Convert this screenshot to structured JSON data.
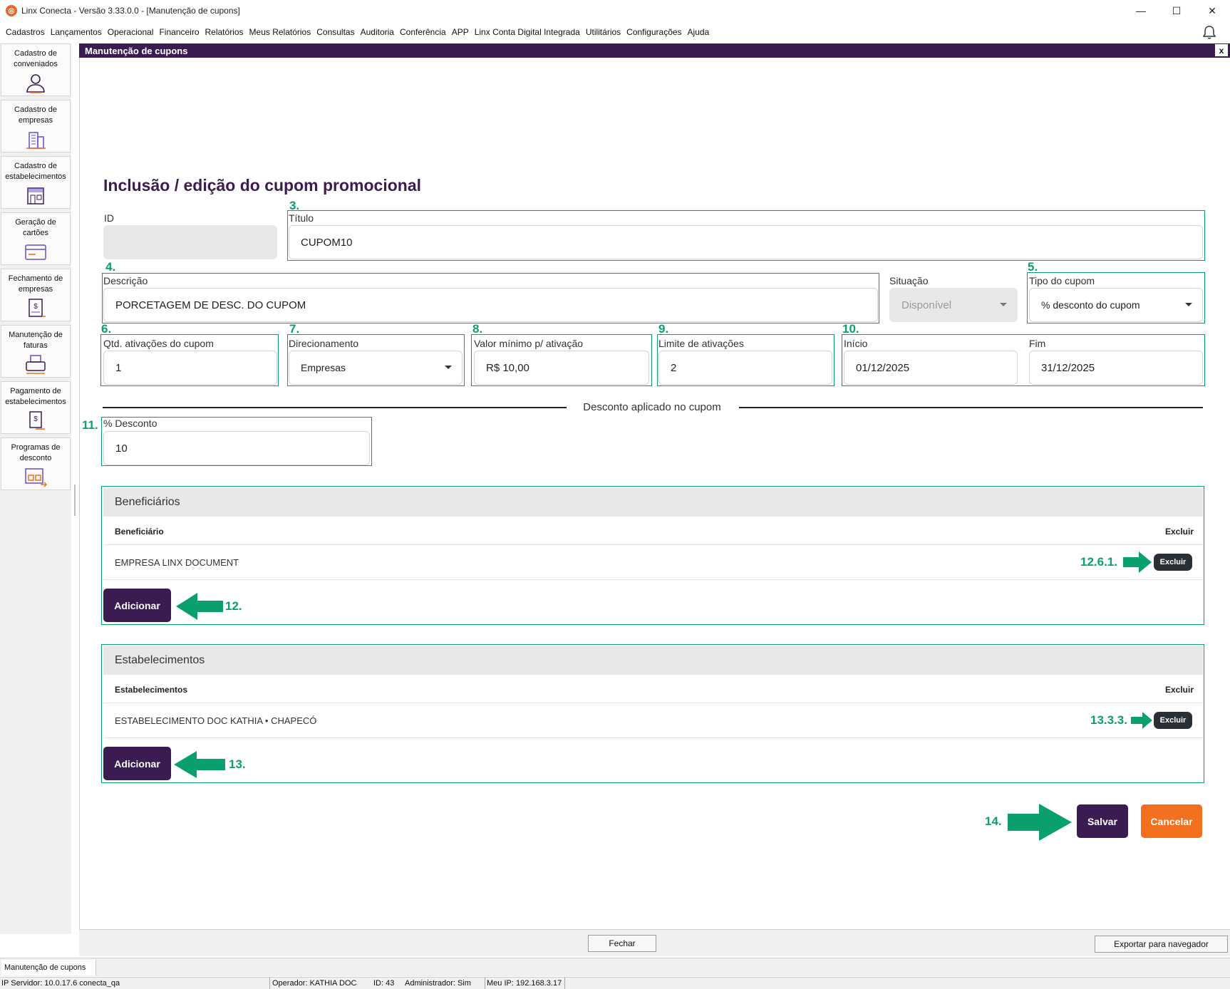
{
  "window": {
    "title": "Linx Conecta - Versão 3.33.0.0 - [Manutenção de cupons]",
    "minimize": "—",
    "maximize": "☐",
    "close": "✕"
  },
  "menu": [
    "Cadastros",
    "Lançamentos",
    "Operacional",
    "Financeiro",
    "Relatórios",
    "Meus Relatórios",
    "Consultas",
    "Auditoria",
    "Conferência",
    "APP",
    "Linx Conta Digital Integrada",
    "Utilitários",
    "Configurações",
    "Ajuda"
  ],
  "sidebar": [
    {
      "label": "Cadastro de conveniados",
      "icon": "user-icon"
    },
    {
      "label": "Cadastro de empresas",
      "icon": "building-icon"
    },
    {
      "label": "Cadastro de estabelecimentos",
      "icon": "storefront-icon"
    },
    {
      "label": "Geração de cartões",
      "icon": "card-icon"
    },
    {
      "label": "Fechamento de empresas",
      "icon": "invoice-dollar-icon"
    },
    {
      "label": "Manutenção de faturas",
      "icon": "printer-icon"
    },
    {
      "label": "Pagamento de estabelecimentos",
      "icon": "payment-icon"
    },
    {
      "label": "Programas de desconto",
      "icon": "discount-program-icon"
    }
  ],
  "document": {
    "header": "Manutenção de cupons",
    "close": "x",
    "page_title": "Inclusão / edição do cupom promocional"
  },
  "form": {
    "id": {
      "label": "ID",
      "value": ""
    },
    "titulo": {
      "label": "Título",
      "value": "CUPOM10",
      "callout": "3."
    },
    "descricao": {
      "label": "Descrição",
      "value": "PORCETAGEM DE DESC. DO CUPOM",
      "callout": "4."
    },
    "situacao": {
      "label": "Situação",
      "value": "Disponível"
    },
    "tipo": {
      "label": "Tipo do cupom",
      "value": "% desconto do cupom",
      "callout": "5."
    },
    "qtd": {
      "label": "Qtd. ativações do cupom",
      "value": "1",
      "callout": "6."
    },
    "direcionamento": {
      "label": "Direcionamento",
      "value": "Empresas",
      "callout": "7."
    },
    "valor_minimo": {
      "label": "Valor mínimo p/ ativação",
      "value": "R$ 10,00",
      "callout": "8."
    },
    "limite": {
      "label": "Limite de ativações",
      "value": "2",
      "callout": "9."
    },
    "inicio": {
      "label": "Início",
      "value": "01/12/2025",
      "callout": "10."
    },
    "fim": {
      "label": "Fim",
      "value": "31/12/2025"
    },
    "divider": "Desconto aplicado no cupom",
    "desconto": {
      "label": "% Desconto",
      "value": "10",
      "callout": "11."
    }
  },
  "beneficiarios": {
    "title": "Beneficiários",
    "col_name": "Beneficiário",
    "col_action": "Excluir",
    "row": "EMPRESA LINX DOCUMENT",
    "row_action": "Excluir",
    "row_callout": "12.6.1.",
    "add": "Adicionar",
    "add_callout": "12."
  },
  "estabelecimentos": {
    "title": "Estabelecimentos",
    "col_name": "Estabelecimentos",
    "col_action": "Excluir",
    "row": "ESTABELECIMENTO DOC KATHIA • CHAPECÓ",
    "row_action": "Excluir",
    "row_callout": "13.3.3.",
    "add": "Adicionar",
    "add_callout": "13."
  },
  "actions": {
    "save": "Salvar",
    "cancel": "Cancelar",
    "save_callout": "14."
  },
  "footer": {
    "close": "Fechar",
    "export": "Exportar para navegador"
  },
  "task_tab": "Manutenção de cupons",
  "status": {
    "server": "IP Servidor: 10.0.17.6 conecta_qa",
    "operator": "Operador: KATHIA DOC",
    "id": "ID: 43",
    "admin": "Administrador: Sim",
    "ip": "Meu IP: 192.168.3.17"
  },
  "colors": {
    "brand_purple": "#3b1c52",
    "callout_green": "#0aa06e",
    "cancel_orange": "#f2701f"
  }
}
